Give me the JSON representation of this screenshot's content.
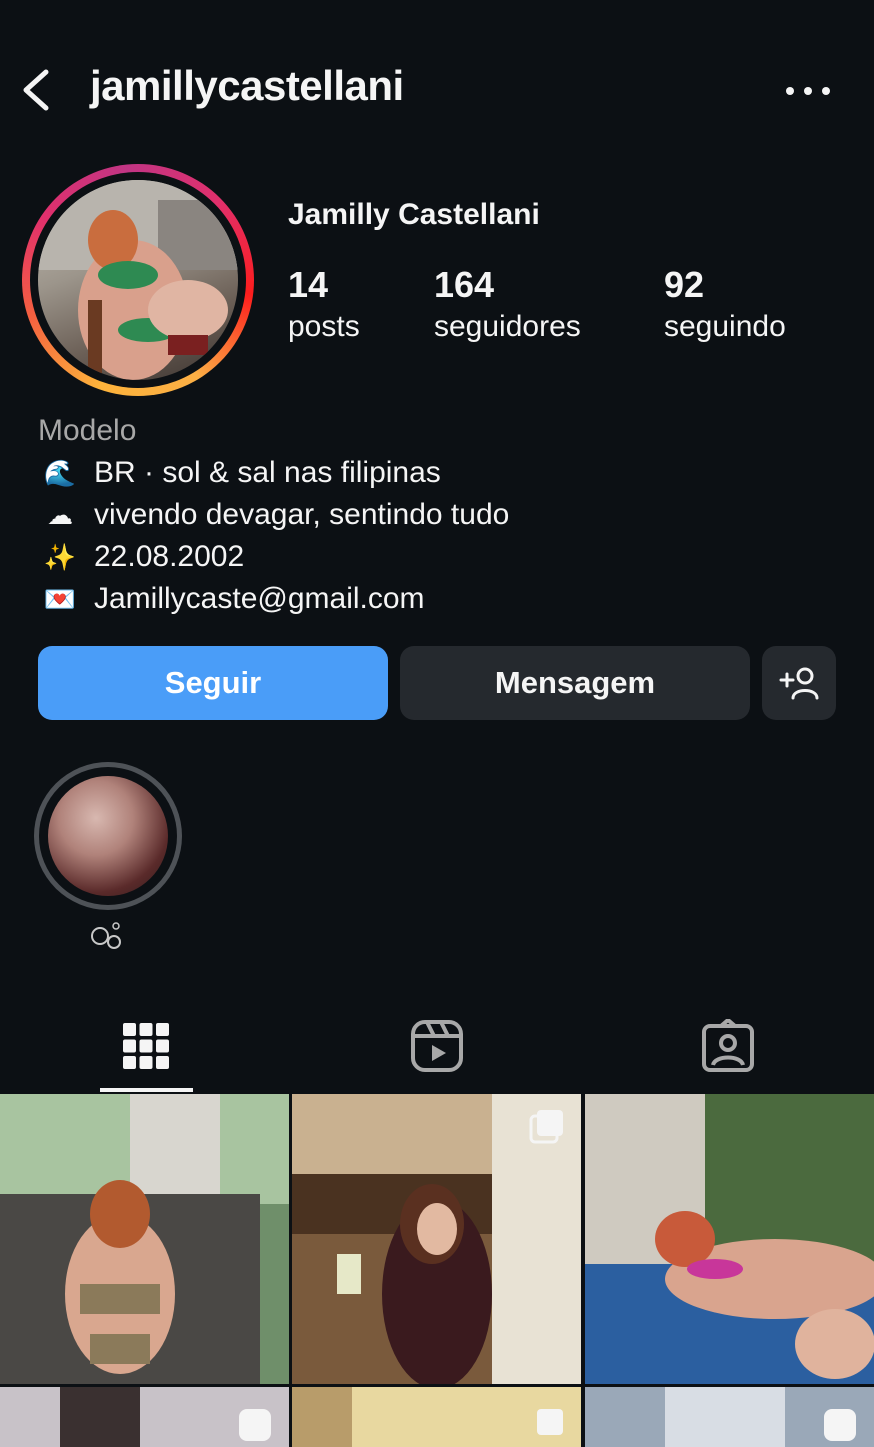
{
  "header": {
    "username": "jamillycastellani",
    "back_icon": "chevron-left-icon",
    "more_icon": "ellipsis-icon"
  },
  "profile": {
    "full_name": "Jamilly Castellani",
    "stats": [
      {
        "value": "14",
        "label": "posts"
      },
      {
        "value": "164",
        "label": "seguidores"
      },
      {
        "value": "92",
        "label": "seguindo"
      }
    ]
  },
  "bio": {
    "category": "Modelo",
    "lines": [
      {
        "emoji": "🌊",
        "text": "BR · sol & sal nas filipinas"
      },
      {
        "emoji": "☁",
        "text": "vivendo devagar, sentindo tudo"
      },
      {
        "emoji": "✨",
        "text": "22.08.2002"
      },
      {
        "emoji": "💌",
        "text": "Jamillycaste@gmail.com"
      }
    ]
  },
  "actions": {
    "follow_label": "Seguir",
    "message_label": "Mensagem",
    "add_icon": "add-person-icon"
  },
  "highlights": [
    {
      "label_icon": "bubbles-icon"
    }
  ],
  "tabs": [
    {
      "icon": "grid-icon",
      "active": true
    },
    {
      "icon": "reels-icon",
      "active": false
    },
    {
      "icon": "tagged-icon",
      "active": false
    }
  ],
  "colors": {
    "background": "#0c1014",
    "primary_button": "#4a9df8",
    "secondary_button": "#25292e",
    "muted_text": "#a8a8a8"
  }
}
